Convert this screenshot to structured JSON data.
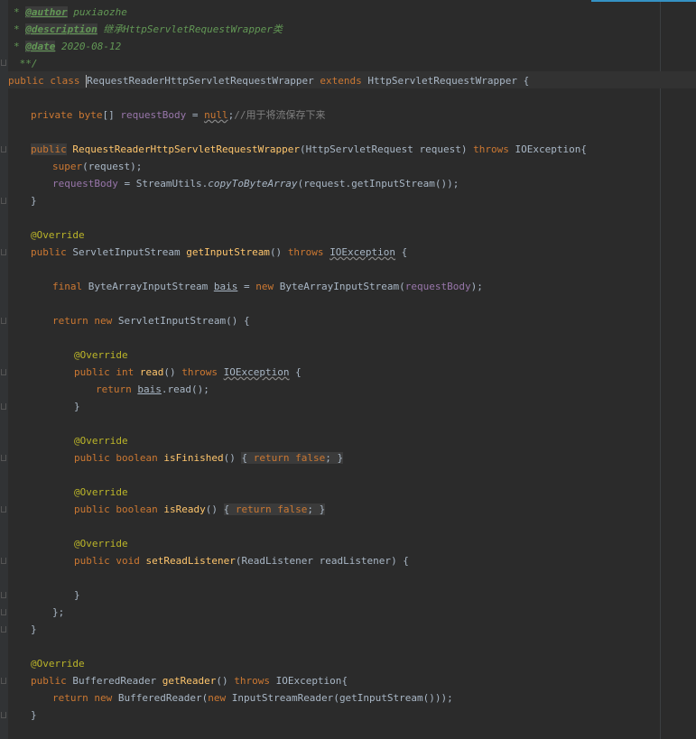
{
  "code": {
    "doc_author_tag": "@author",
    "doc_author_value": " puxiaozhe",
    "doc_description_tag": "@description",
    "doc_description_value": " 继承HttpServletRequestWrapper类",
    "doc_date_tag": "@date",
    "doc_date_value": " 2020-08-12",
    "doc_close": " **/",
    "kw_public": "public",
    "kw_class": "class",
    "kw_extends": "extends",
    "kw_private": "private",
    "kw_byte": "byte",
    "kw_null": "null",
    "kw_throws": "throws",
    "kw_super": "super",
    "kw_final": "final",
    "kw_new": "new",
    "kw_return": "return",
    "kw_int": "int",
    "kw_boolean": "boolean",
    "kw_false": "false",
    "kw_void": "void",
    "annotation_override": "@Override",
    "class_name": "RequestReaderHttpServletRequestWrapper",
    "super_class": "HttpServletRequestWrapper",
    "field_requestBody": "requestBody",
    "comment_store": "//用于将流保存下来",
    "ctor_name": "RequestReaderHttpServletRequestWrapper",
    "type_HttpServletRequest": "HttpServletRequest",
    "param_request": "request",
    "type_IOException": "IOException",
    "type_StreamUtils": "StreamUtils",
    "method_copyToByteArray": "copyToByteArray",
    "call_getInputStream": "request.getInputStream());",
    "type_ServletInputStream": "ServletInputStream",
    "method_getInputStream": "getInputStream",
    "type_ByteArrayInputStream": "ByteArrayInputStream",
    "var_bais": "bais",
    "method_read": "read",
    "method_isFinished": "isFinished",
    "method_isReady": "isReady",
    "method_setReadListener": "setReadListener",
    "type_ReadListener": "ReadListener",
    "param_readListener": "readListener",
    "type_BufferedReader": "BufferedReader",
    "method_getReader": "getReader",
    "type_InputStreamReader": "InputStreamReader",
    "call_getInputStream2": "getInputStream()));"
  }
}
